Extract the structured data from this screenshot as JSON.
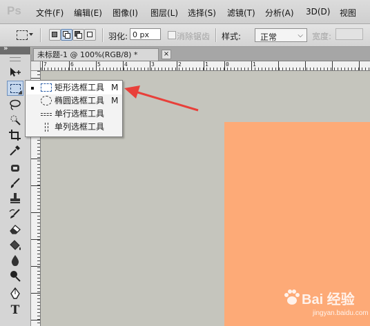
{
  "app": {
    "logo": "Ps"
  },
  "menu": [
    "文件(F)",
    "编辑(E)",
    "图像(I)",
    "图层(L)",
    "选择(S)",
    "滤镜(T)",
    "分析(A)",
    "3D(D)",
    "视图"
  ],
  "options_bar": {
    "feather_label": "羽化:",
    "feather_value": "0 px",
    "antialias_label": "消除锯齿",
    "style_label": "样式:",
    "style_value": "正常",
    "width_label": "宽度:"
  },
  "document": {
    "tab_title": "未标题-1 @ 100%(RGB/8) *",
    "close_symbol": "×"
  },
  "ruler": {
    "top_labels": [
      "7",
      "6",
      "5",
      "4",
      "3",
      "2",
      "1",
      "0",
      "1"
    ]
  },
  "toolbar": {
    "collapse_symbol": "»",
    "tools": [
      {
        "name": "move-tool-icon",
        "glyph": "▸✛"
      },
      {
        "name": "rect-marquee-tool-icon",
        "glyph": ""
      },
      {
        "name": "lasso-tool-icon",
        "glyph": "ᓬ"
      },
      {
        "name": "quick-select-tool-icon",
        "glyph": "✧"
      },
      {
        "name": "crop-tool-icon",
        "glyph": "⌗"
      },
      {
        "name": "eyedropper-tool-icon",
        "glyph": "✎"
      },
      {
        "name": "healing-brush-tool-icon",
        "glyph": "✜"
      },
      {
        "name": "brush-tool-icon",
        "glyph": "✐"
      },
      {
        "name": "clone-stamp-tool-icon",
        "glyph": "⏚"
      },
      {
        "name": "history-brush-tool-icon",
        "glyph": "✑"
      },
      {
        "name": "eraser-tool-icon",
        "glyph": "◩"
      },
      {
        "name": "paint-bucket-tool-icon",
        "glyph": "◭"
      },
      {
        "name": "blur-tool-icon",
        "glyph": "💧"
      },
      {
        "name": "dodge-tool-icon",
        "glyph": "●"
      },
      {
        "name": "pen-tool-icon",
        "glyph": "✒"
      },
      {
        "name": "type-tool-icon",
        "glyph": "T"
      }
    ]
  },
  "flyout": {
    "items": [
      {
        "label": "矩形选框工具",
        "shortcut": "M",
        "current": true
      },
      {
        "label": "椭圆选框工具",
        "shortcut": "M",
        "current": false
      },
      {
        "label": "单行选框工具",
        "shortcut": "",
        "current": false
      },
      {
        "label": "单列选框工具",
        "shortcut": "",
        "current": false
      }
    ]
  },
  "colors": {
    "canvas_fill": "#fdaa77",
    "pasteboard": "#c5c5bd",
    "annotation_arrow": "#e8403a"
  },
  "watermark": {
    "main": "Bai 经验",
    "sub": "jingyan.baidu.com"
  }
}
